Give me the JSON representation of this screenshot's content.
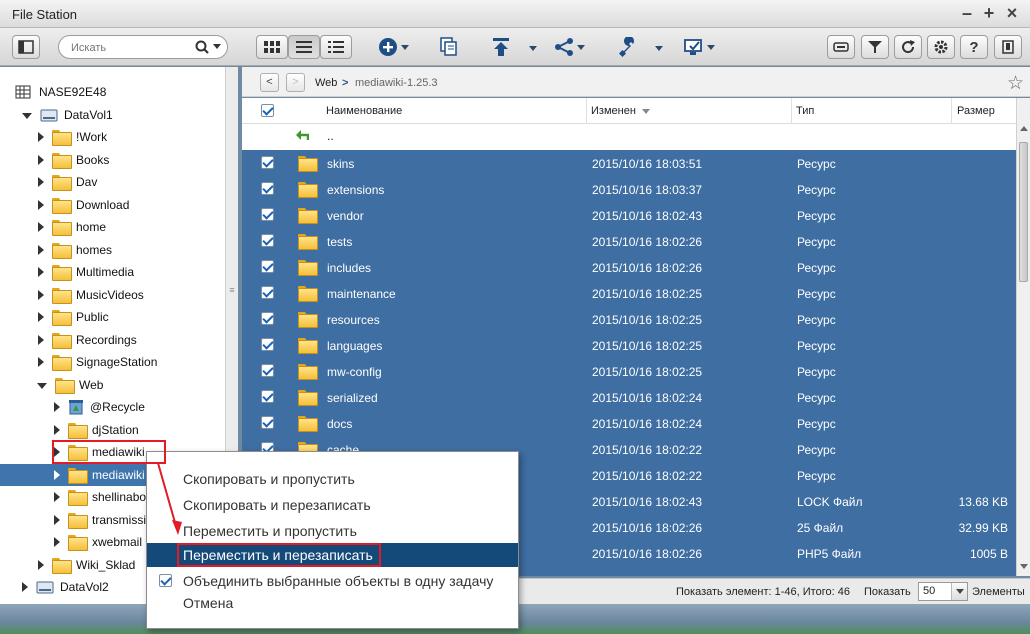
{
  "window": {
    "title": "File Station"
  },
  "toolbar": {
    "search_placeholder": "Искать",
    "icons": [
      "list-view-icon",
      "search-icon",
      "thumbnail-view-icon",
      "detail-view-icon",
      "list-compact-icon",
      "create-icon",
      "copy-icon",
      "upload-icon",
      "share-icon",
      "tools-icon",
      "remote-mount-icon",
      "filter-icon",
      "refresh-icon",
      "settings-icon",
      "help-icon",
      "more-icon"
    ]
  },
  "tree": {
    "root": "NASE92E48",
    "items": [
      {
        "label": "DataVol1"
      },
      {
        "label": "!Work"
      },
      {
        "label": "Books"
      },
      {
        "label": "Dav"
      },
      {
        "label": "Download"
      },
      {
        "label": "home"
      },
      {
        "label": "homes"
      },
      {
        "label": "Multimedia"
      },
      {
        "label": "MusicVideos"
      },
      {
        "label": "Public"
      },
      {
        "label": "Recordings"
      },
      {
        "label": "SignageStation"
      },
      {
        "label": "Web"
      },
      {
        "label": "@Recycle"
      },
      {
        "label": "djStation"
      },
      {
        "label": "mediawiki"
      },
      {
        "label": "mediawiki"
      },
      {
        "label": "shellinabox"
      },
      {
        "label": "transmission"
      },
      {
        "label": "xwebmail"
      },
      {
        "label": "Wiki_Sklad"
      },
      {
        "label": "DataVol2"
      }
    ]
  },
  "path": {
    "back": "<",
    "forward": ">",
    "crumbs": [
      "Web",
      "mediawiki-1.25.3"
    ],
    "separator": ">"
  },
  "table": {
    "headers": {
      "name": "Наименование",
      "modified": "Изменен",
      "type": "Тип",
      "size": "Размер"
    },
    "up_label": "..",
    "rows": [
      {
        "name": "skins",
        "modified": "2015/10/16 18:03:51",
        "type": "Ресурс",
        "size": "",
        "kind": "folder"
      },
      {
        "name": "extensions",
        "modified": "2015/10/16 18:03:37",
        "type": "Ресурс",
        "size": "",
        "kind": "folder"
      },
      {
        "name": "vendor",
        "modified": "2015/10/16 18:02:43",
        "type": "Ресурс",
        "size": "",
        "kind": "folder"
      },
      {
        "name": "tests",
        "modified": "2015/10/16 18:02:26",
        "type": "Ресурс",
        "size": "",
        "kind": "folder"
      },
      {
        "name": "includes",
        "modified": "2015/10/16 18:02:26",
        "type": "Ресурс",
        "size": "",
        "kind": "folder"
      },
      {
        "name": "maintenance",
        "modified": "2015/10/16 18:02:25",
        "type": "Ресурс",
        "size": "",
        "kind": "folder"
      },
      {
        "name": "resources",
        "modified": "2015/10/16 18:02:25",
        "type": "Ресурс",
        "size": "",
        "kind": "folder"
      },
      {
        "name": "languages",
        "modified": "2015/10/16 18:02:25",
        "type": "Ресурс",
        "size": "",
        "kind": "folder"
      },
      {
        "name": "mw-config",
        "modified": "2015/10/16 18:02:25",
        "type": "Ресурс",
        "size": "",
        "kind": "folder"
      },
      {
        "name": "serialized",
        "modified": "2015/10/16 18:02:24",
        "type": "Ресурс",
        "size": "",
        "kind": "folder"
      },
      {
        "name": "docs",
        "modified": "2015/10/16 18:02:24",
        "type": "Ресурс",
        "size": "",
        "kind": "folder"
      },
      {
        "name": "cache",
        "modified": "2015/10/16 18:02:22",
        "type": "Ресурс",
        "size": "",
        "kind": "folder"
      },
      {
        "name": "",
        "modified": "2015/10/16 18:02:22",
        "type": "Ресурс",
        "size": "",
        "kind": "folder"
      },
      {
        "name": "",
        "modified": "2015/10/16 18:02:43",
        "type": "LOCK Файл",
        "size": "13.68 KB",
        "kind": "file"
      },
      {
        "name": "",
        "modified": "2015/10/16 18:02:26",
        "type": "25 Файл",
        "size": "32.99 KB",
        "kind": "file"
      },
      {
        "name": "",
        "modified": "2015/10/16 18:02:26",
        "type": "PHP5 Файл",
        "size": "1005 B",
        "kind": "file"
      }
    ]
  },
  "status": {
    "showing": "Показать элемент: 1-46, Итого: 46",
    "show_label": "Показать",
    "page_size": "50",
    "items_label": "Элементы"
  },
  "context_menu": {
    "items": [
      {
        "label": "Скопировать и пропустить"
      },
      {
        "label": "Скопировать и перезаписать"
      },
      {
        "label": "Переместить и пропустить"
      },
      {
        "label": "Переместить и перезаписать"
      },
      {
        "label": "Объединить выбранные объекты в одну задачу"
      },
      {
        "label": "Отмена"
      }
    ]
  },
  "colors": {
    "selection": "#3e6ea2",
    "menu_highlight": "#144a7a",
    "annotation_red": "#e21b25"
  }
}
